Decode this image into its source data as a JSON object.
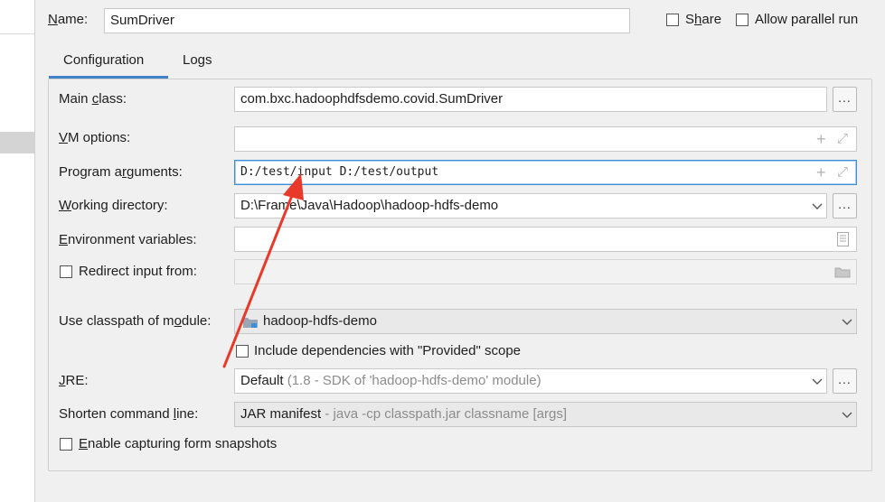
{
  "name_label": "Name:",
  "name_value": "SumDriver",
  "share_label": "Share",
  "allow_parallel_label": "Allow parallel run",
  "tabs": [
    {
      "label": "Configuration",
      "active": true
    },
    {
      "label": "Logs",
      "active": false
    }
  ],
  "main_class": {
    "label": "Main class:",
    "value": "com.bxc.hadoophdfsdemo.covid.SumDriver",
    "button": "..."
  },
  "vm_options": {
    "label": "VM options:",
    "value": ""
  },
  "program_arguments": {
    "label": "Program arguments:",
    "value": "D:/test/input D:/test/output"
  },
  "working_directory": {
    "label": "Working directory:",
    "value": "D:\\Frame\\Java\\Hadoop\\hadoop-hdfs-demo",
    "button": "..."
  },
  "environment_variables": {
    "label": "Environment variables:",
    "value": ""
  },
  "redirect_input": {
    "label": "Redirect input from:",
    "checked": false,
    "value": ""
  },
  "classpath_module": {
    "label": "Use classpath of module:",
    "value": "hadoop-hdfs-demo"
  },
  "include_dependencies": {
    "label": "Include dependencies with \"Provided\" scope",
    "checked": false
  },
  "jre": {
    "label": "JRE:",
    "value": "Default",
    "hint": "(1.8 - SDK of 'hadoop-hdfs-demo' module)",
    "button": "..."
  },
  "shorten_command_line": {
    "label": "Shorten command line:",
    "value": "JAR manifest",
    "hint": "- java -cp classpath.jar classname [args]"
  },
  "enable_snapshots": {
    "label": "Enable capturing form snapshots",
    "checked": false
  },
  "colors": {
    "accent": "#3d8fd6",
    "annotation_arrow": "#e8392a",
    "tab_underline": "#4083c9"
  }
}
